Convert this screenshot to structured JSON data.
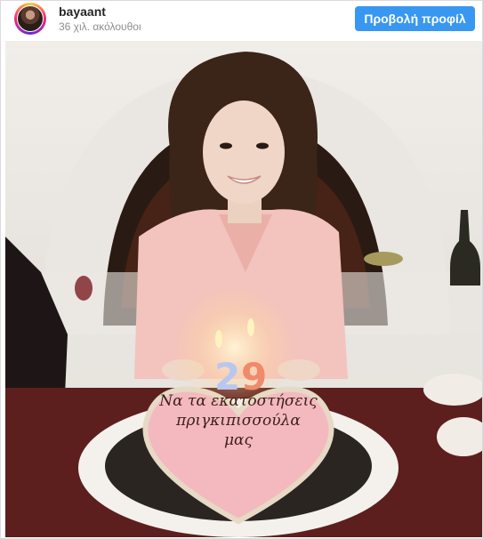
{
  "header": {
    "username": "bayaant",
    "followers": "36 χιλ. ακόλουθοι",
    "profile_button": "Προβολή προφίλ"
  },
  "post": {
    "cake_text": [
      "Να τα εκατοστήσεις",
      "πριγκιπισσούλα",
      "μας"
    ],
    "candles": [
      "2",
      "9"
    ]
  },
  "colors": {
    "button": "#3897f0",
    "blouse": "#f3c3bd",
    "cake_frosting": "#f4b9bf"
  }
}
